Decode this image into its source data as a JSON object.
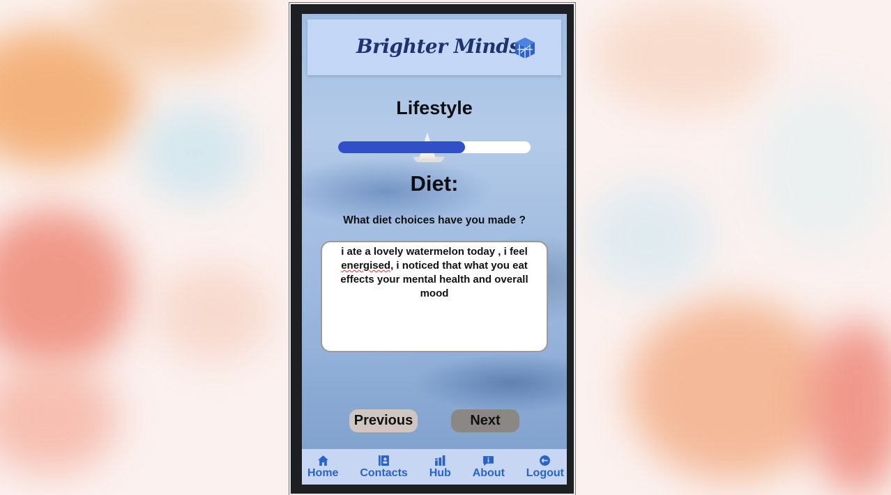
{
  "header": {
    "brand": "Brighter Minds",
    "logo_icon": "cube-logo-icon"
  },
  "section": {
    "title": "Lifestyle"
  },
  "progress": {
    "fraction": 0.66
  },
  "question": {
    "title": "Diet:",
    "prompt": "What diet choices have you made ?",
    "answer_before": "i ate a lovely watermelon today , i feel ",
    "answer_typo": "energised",
    "answer_after": ", i noticed that what you eat effects your mental health and overall mood"
  },
  "buttons": {
    "previous": "Previous",
    "next": "Next"
  },
  "nav": {
    "items": [
      {
        "label": "Home",
        "icon": "home-icon"
      },
      {
        "label": "Contacts",
        "icon": "contacts-icon"
      },
      {
        "label": "Hub",
        "icon": "hub-icon"
      },
      {
        "label": "About",
        "icon": "about-icon"
      },
      {
        "label": "Logout",
        "icon": "logout-icon"
      }
    ]
  },
  "colors": {
    "accent": "#3150c8",
    "brand": "#1e3270",
    "nav_text": "#2a63c8",
    "header_bg": "#c4d7f6"
  }
}
